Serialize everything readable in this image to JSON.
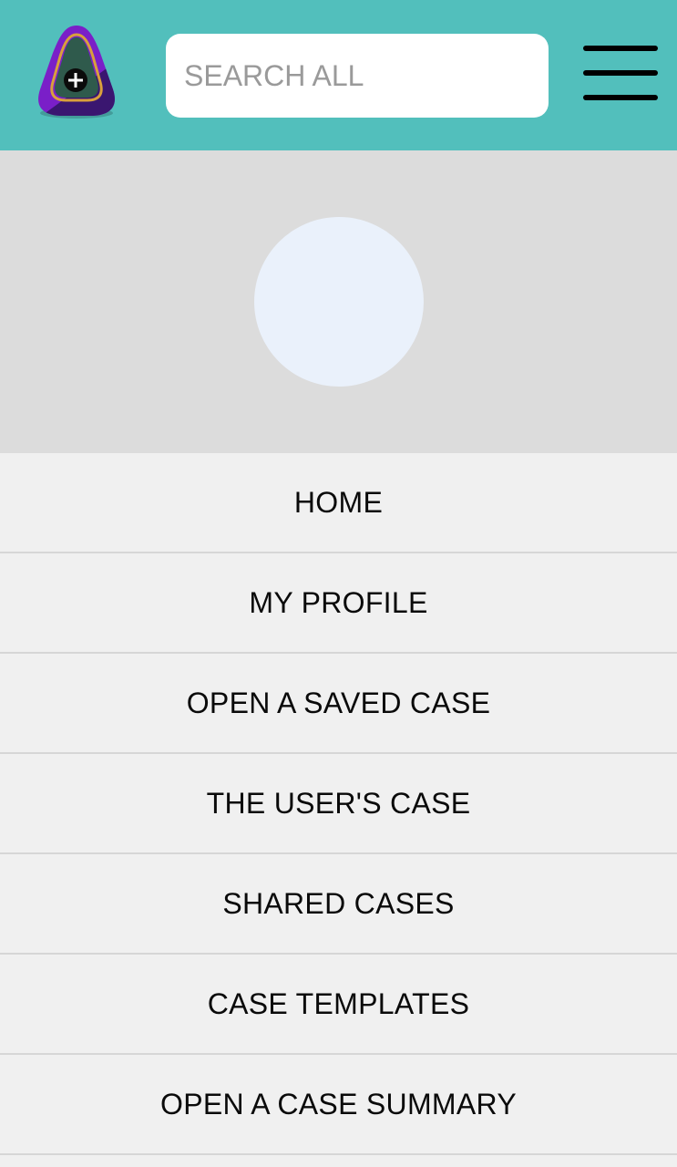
{
  "header": {
    "logo_icon": "app-logo-plus-icon",
    "search": {
      "placeholder": "SEARCH ALL",
      "value": ""
    },
    "menu_icon": "hamburger-menu-icon",
    "colors": {
      "header_bg": "#52bfbc",
      "logo_purple": "#7a1fc8",
      "logo_dark": "#3a1670",
      "logo_green": "#2f5a4c",
      "logo_gold": "#d9a03c"
    }
  },
  "profile": {
    "avatar_icon": "avatar-placeholder",
    "background": "#dcdcdc",
    "avatar_color": "#eaf1fb"
  },
  "menu": {
    "items": [
      {
        "label": "HOME"
      },
      {
        "label": "MY PROFILE"
      },
      {
        "label": "OPEN A SAVED CASE"
      },
      {
        "label": "THE USER'S CASE"
      },
      {
        "label": "SHARED CASES"
      },
      {
        "label": "CASE TEMPLATES"
      },
      {
        "label": "OPEN A CASE SUMMARY"
      }
    ]
  }
}
